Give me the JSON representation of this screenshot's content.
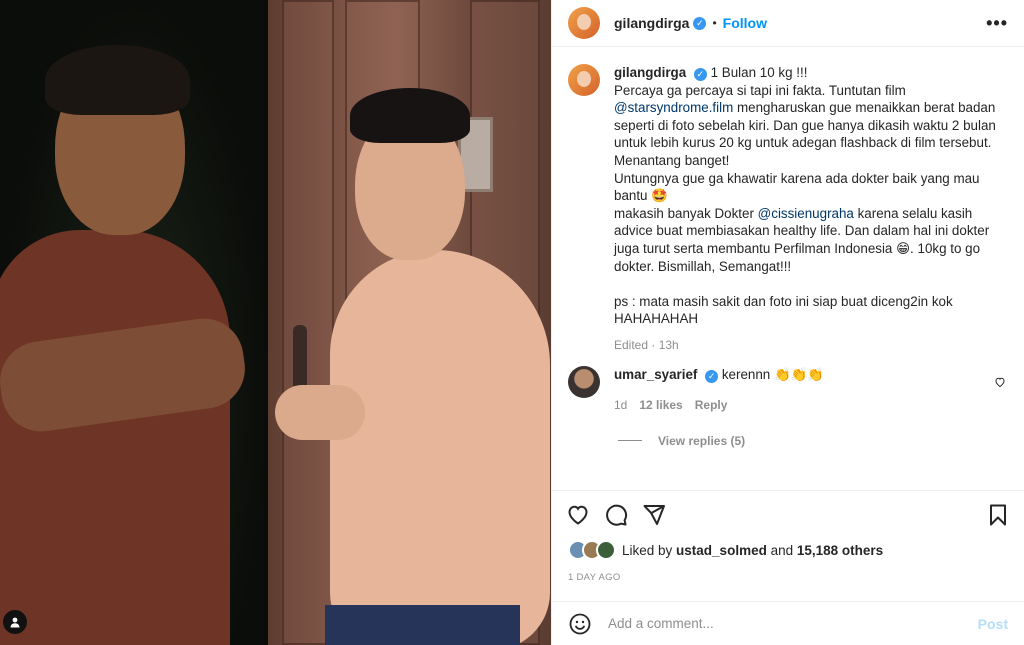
{
  "header": {
    "username": "gilangdirga",
    "separator": "•",
    "follow_label": "Follow",
    "more_label": "•••"
  },
  "caption": {
    "username": "gilangdirga",
    "line1": "1 Bulan 10 kg !!!",
    "line2": "Percaya ga percaya si tapi ini fakta. Tuntutan film",
    "mention1": "@starsyndrome.film",
    "line3": " mengharuskan gue menaikkan berat badan seperti di foto sebelah kiri. Dan gue hanya dikasih waktu 2 bulan untuk lebih kurus 20 kg untuk adegan flashback di film tersebut. Menantang banget!\nUntungnya gue ga khawatir karena ada dokter baik yang mau bantu 🤩\nmakasih banyak Dokter ",
    "mention2": "@cissienugraha",
    "line4": " karena selalu kasih advice buat membiasakan healthy life. Dan dalam hal ini dokter juga turut serta membantu Perfilman Indonesia 😁. 10kg to go dokter. Bismillah, Semangat!!!\n\nps : mata masih sakit dan foto ini siap buat diceng2in kok HAHAHAHAH",
    "meta": "Edited · 13h"
  },
  "comment": {
    "username": "umar_syarief",
    "text": "kerennn 👏👏👏",
    "age": "1d",
    "likes": "12 likes",
    "reply_label": "Reply",
    "view_replies": "View replies (5)"
  },
  "likes": {
    "prefix": "Liked by ",
    "user": "ustad_solmed",
    "middle": " and ",
    "count": "15,188 others"
  },
  "date": "1 DAY AGO",
  "add_comment": {
    "placeholder": "Add a comment...",
    "post_label": "Post"
  },
  "colors": {
    "accent": "#0095f6",
    "mention": "#00376b",
    "muted": "#8e8e8e",
    "verified": "#3897f0"
  },
  "icons": [
    "tag-user-icon",
    "verified-icon",
    "more-icon",
    "heart-icon",
    "comment-icon",
    "share-icon",
    "bookmark-icon",
    "emoji-icon"
  ]
}
